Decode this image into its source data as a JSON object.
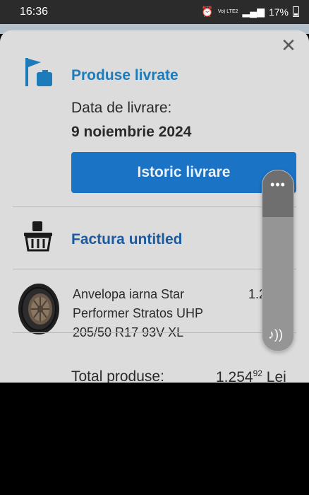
{
  "status_bar": {
    "time": "16:36",
    "network": "Vo) LTE2",
    "battery": "17%",
    "icons": [
      "alarm-icon",
      "wifi-icon",
      "signal-icon",
      "battery-icon"
    ]
  },
  "sheet": {
    "close_icon": "close-icon",
    "delivered": {
      "icon": "flag-box-icon",
      "title": "Produse livrate",
      "date_label": "Data de livrare:",
      "date_value": "9 noiembrie 2024",
      "button_label": "Istoric livrare"
    },
    "invoice": {
      "icon": "basket-icon",
      "title": "Factura untitled",
      "chevron": "chevron-right-icon"
    },
    "product": {
      "icon": "tire-icon",
      "name": "Anvelopa iarna Star Performer Stratos UHP 205/50 R17 93V XL",
      "price_visible": "1.2",
      "price_cents_visible": "2"
    },
    "total": {
      "label": "Total produse:",
      "value": "1.254",
      "cents": "92",
      "currency": "Lei"
    }
  },
  "volume_panel": {
    "menu_icon": "more-dots-icon",
    "media_icon": "music-note-icon",
    "level": 0.25
  },
  "colors": {
    "accent_blue": "#1c7bb8",
    "button_blue": "#1b73c6",
    "sheet_bg": "#dcdcdc"
  }
}
